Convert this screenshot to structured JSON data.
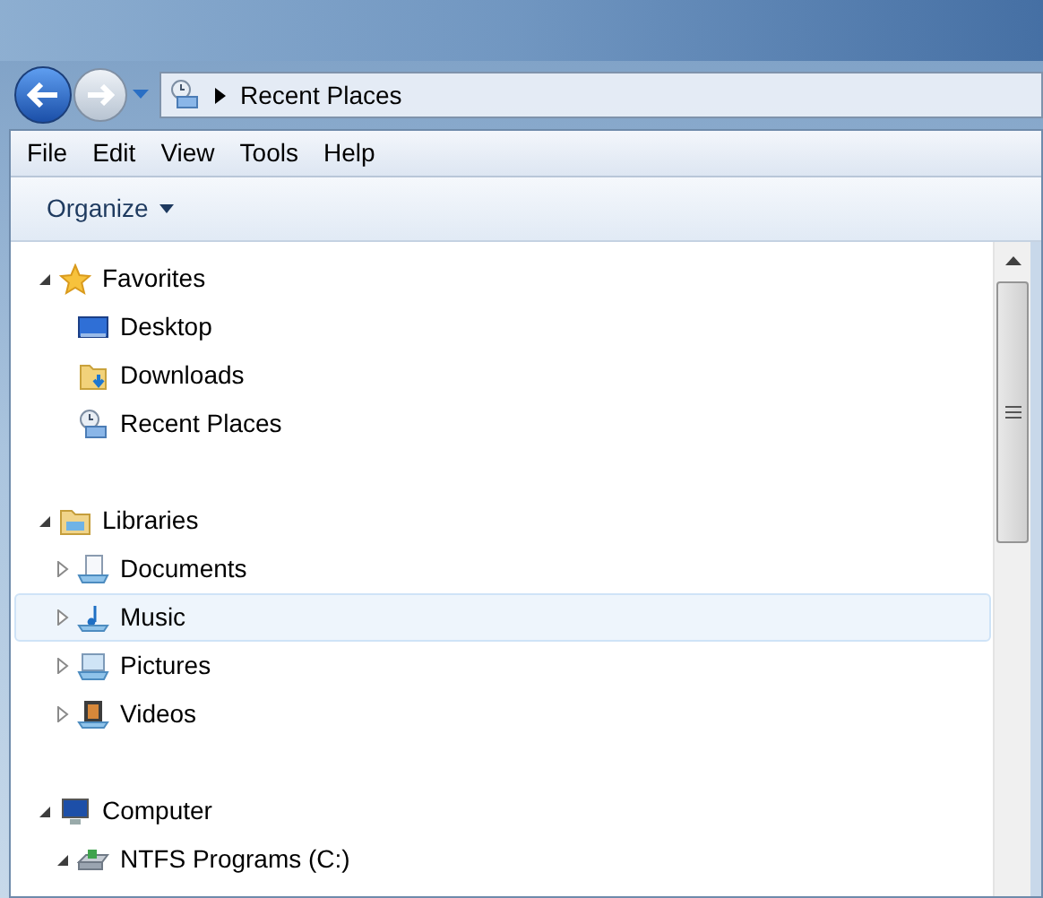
{
  "address_bar": {
    "crumbs": [
      "Recent Places"
    ]
  },
  "menu_bar": [
    "File",
    "Edit",
    "View",
    "Tools",
    "Help"
  ],
  "toolbar": {
    "organize": "Organize"
  },
  "tree": [
    {
      "label": "Favorites",
      "kind": "star",
      "expanded": true,
      "selected": false,
      "children": [
        {
          "label": "Desktop",
          "kind": "desktop",
          "selected": false
        },
        {
          "label": "Downloads",
          "kind": "downloads",
          "selected": false
        },
        {
          "label": "Recent Places",
          "kind": "recent",
          "selected": false
        }
      ]
    },
    {
      "label": "Libraries",
      "kind": "library",
      "expanded": true,
      "selected": false,
      "children": [
        {
          "label": "Documents",
          "kind": "documents",
          "expanded": false,
          "selected": false
        },
        {
          "label": "Music",
          "kind": "music",
          "expanded": false,
          "selected": true
        },
        {
          "label": "Pictures",
          "kind": "pictures",
          "expanded": false,
          "selected": false
        },
        {
          "label": "Videos",
          "kind": "videos",
          "expanded": false,
          "selected": false
        }
      ]
    },
    {
      "label": "Computer",
      "kind": "computer",
      "expanded": true,
      "selected": false,
      "children": [
        {
          "label": "NTFS Programs (C:)",
          "kind": "drive",
          "expanded": true,
          "selected": false
        }
      ]
    }
  ]
}
